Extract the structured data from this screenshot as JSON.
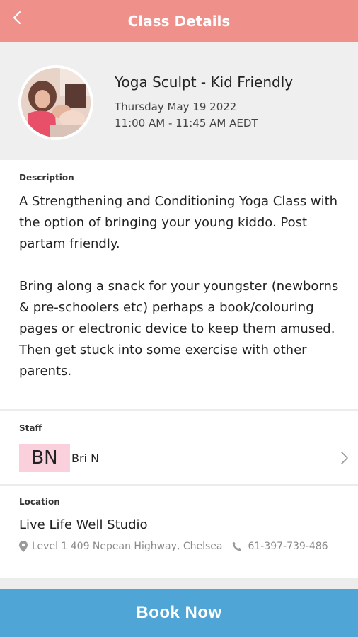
{
  "header": {
    "title": "Class Details",
    "back_icon": "chevron-left-icon"
  },
  "class": {
    "name": "Yoga Sculpt - Kid Friendly",
    "date": "Thursday May 19 2022",
    "time": "11:00 AM - 11:45 AM AEDT",
    "image": "class-photo"
  },
  "description": {
    "label": "Description",
    "text": "A Strengthening and Conditioning Yoga Class with the option of bringing your young kiddo. Post partam friendly.\n\nBring along a snack for your youngster (newborns & pre-schoolers etc) perhaps a book/colouring pages or electronic device to keep them amused.\nThen get stuck into some exercise with other parents."
  },
  "staff": {
    "label": "Staff",
    "initials": "BN",
    "name": "Bri N",
    "initials_bg": "#f9d0dc"
  },
  "location": {
    "label": "Location",
    "name": "Live Life Well Studio",
    "address": "Level 1 409 Nepean Highway, Chelsea",
    "phone": "61-397-739-486"
  },
  "cta": {
    "label": "Book Now",
    "color": "#4ea5d6"
  },
  "colors": {
    "header": "#f0908a",
    "cta": "#4ea5d6"
  }
}
